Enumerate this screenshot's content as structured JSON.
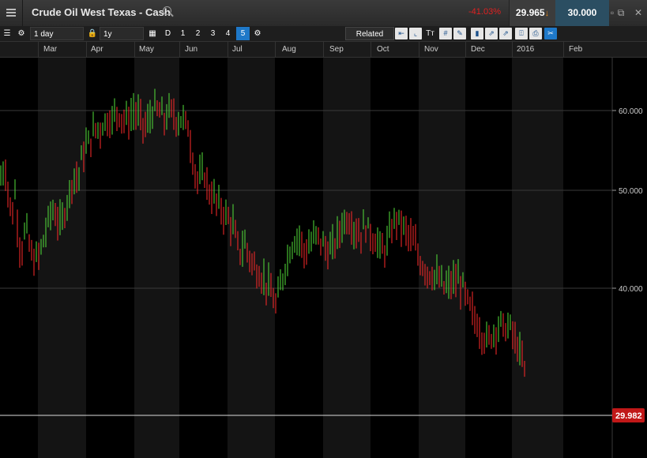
{
  "window": {
    "title": "Crude Oil West Texas - Cash",
    "change": "-41.03%",
    "price": "29.965",
    "sell_price": "30.000"
  },
  "toolbar": {
    "interval": "1 day",
    "range": "1y",
    "d_label": "D",
    "segments": [
      "1",
      "2",
      "3",
      "4",
      "5"
    ],
    "active_segment": "5",
    "related_label": "Related"
  },
  "axis": {
    "months": [
      "Mar",
      "Apr",
      "May",
      "Jun",
      "Jul",
      "Aug",
      "Sep",
      "Oct",
      "Nov",
      "Dec",
      "2016",
      "Feb"
    ],
    "y_ticks": [
      "60.000",
      "50.000",
      "40.000"
    ],
    "current_price_label": "29.982"
  },
  "colors": {
    "up": "#55e03a",
    "down": "#ff2a2a",
    "accent": "#1e78c8",
    "price_flag": "#c11818"
  },
  "chart_data": {
    "type": "ohlc-bar",
    "ylim": [
      28,
      65
    ],
    "y_ticks": [
      40,
      50,
      60
    ],
    "current_price": 29.982,
    "points": [
      [
        0,
        52
      ],
      [
        0.03,
        54
      ],
      [
        0.06,
        50
      ],
      [
        0.08,
        48
      ],
      [
        0.1,
        51
      ],
      [
        0.12,
        46
      ],
      [
        0.14,
        44
      ],
      [
        0.17,
        47
      ],
      [
        0.19,
        45
      ],
      [
        0.22,
        43
      ],
      [
        0.25,
        43.5
      ],
      [
        0.28,
        45
      ],
      [
        0.31,
        47
      ],
      [
        0.34,
        49
      ],
      [
        0.37,
        48
      ],
      [
        0.4,
        47
      ],
      [
        0.43,
        49
      ],
      [
        0.46,
        51
      ],
      [
        0.49,
        53
      ],
      [
        0.51,
        52
      ],
      [
        0.54,
        55
      ],
      [
        0.57,
        56
      ],
      [
        0.6,
        57
      ],
      [
        0.63,
        58
      ],
      [
        0.66,
        58
      ],
      [
        0.7,
        59
      ],
      [
        0.74,
        59
      ],
      [
        0.77,
        60
      ],
      [
        0.81,
        59
      ],
      [
        0.85,
        59
      ],
      [
        0.88,
        60
      ],
      [
        0.92,
        59
      ],
      [
        0.96,
        58
      ],
      [
        1,
        60
      ],
      [
        1.04,
        60
      ],
      [
        1.08,
        59
      ],
      [
        1.12,
        60
      ],
      [
        1.16,
        59
      ],
      [
        1.2,
        59
      ],
      [
        1.24,
        58
      ],
      [
        1.27,
        54
      ],
      [
        1.3,
        52
      ],
      [
        1.34,
        53
      ],
      [
        1.37,
        51
      ],
      [
        1.41,
        50
      ],
      [
        1.45,
        49
      ],
      [
        1.49,
        48
      ],
      [
        1.53,
        47
      ],
      [
        1.57,
        44
      ],
      [
        1.61,
        45
      ],
      [
        1.65,
        43
      ],
      [
        1.69,
        42
      ],
      [
        1.73,
        41
      ],
      [
        1.77,
        40
      ],
      [
        1.81,
        38
      ],
      [
        1.84,
        40
      ],
      [
        1.88,
        43
      ],
      [
        1.92,
        45
      ],
      [
        1.96,
        46
      ],
      [
        2,
        44
      ],
      [
        2.04,
        45
      ],
      [
        2.08,
        46
      ],
      [
        2.12,
        45
      ],
      [
        2.16,
        44
      ],
      [
        2.2,
        45
      ],
      [
        2.24,
        47
      ],
      [
        2.28,
        48
      ],
      [
        2.32,
        47
      ],
      [
        2.36,
        46
      ],
      [
        2.4,
        47
      ],
      [
        2.44,
        46
      ],
      [
        2.48,
        45
      ],
      [
        2.52,
        44
      ],
      [
        2.56,
        46
      ],
      [
        2.6,
        48
      ],
      [
        2.64,
        47
      ],
      [
        2.68,
        46
      ],
      [
        2.72,
        45
      ],
      [
        2.76,
        43
      ],
      [
        2.8,
        42
      ],
      [
        2.84,
        41.5
      ],
      [
        2.88,
        41
      ],
      [
        2.92,
        40
      ],
      [
        2.96,
        40.5
      ],
      [
        3,
        41
      ],
      [
        3.04,
        40
      ],
      [
        3.08,
        38
      ],
      [
        3.12,
        36.5
      ],
      [
        3.16,
        35
      ],
      [
        3.2,
        34
      ],
      [
        3.24,
        35
      ],
      [
        3.28,
        36
      ],
      [
        3.32,
        35.5
      ],
      [
        3.36,
        35.5
      ],
      [
        3.38,
        34
      ],
      [
        3.41,
        33
      ],
      [
        3.44,
        31
      ],
      [
        3.46,
        29.98
      ]
    ]
  }
}
